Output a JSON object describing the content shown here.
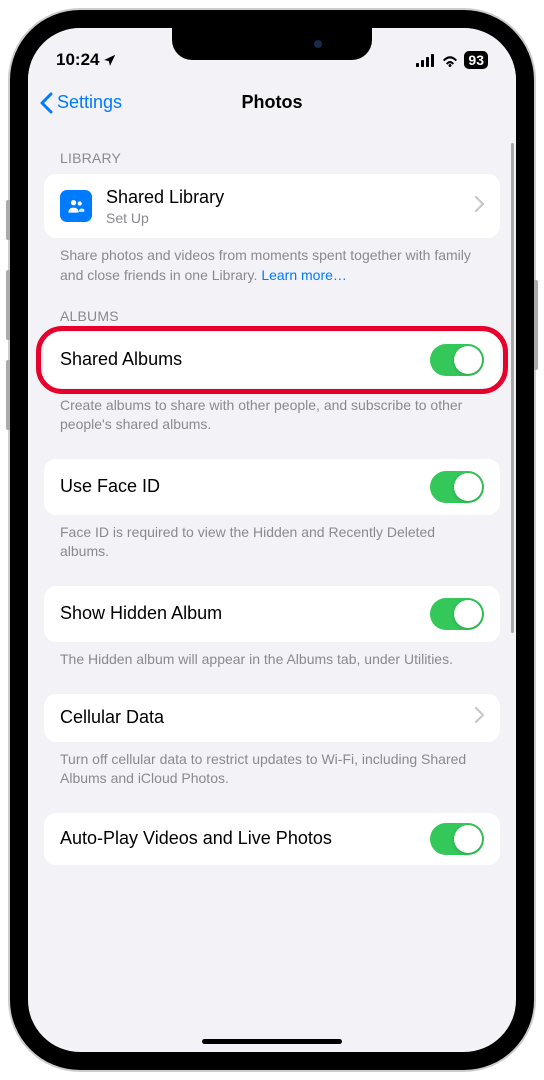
{
  "statusBar": {
    "time": "10:24",
    "battery": "93"
  },
  "nav": {
    "back": "Settings",
    "title": "Photos"
  },
  "sections": {
    "library": {
      "header": "LIBRARY",
      "sharedLibrary": {
        "title": "Shared Library",
        "subtitle": "Set Up"
      },
      "footer": "Share photos and videos from moments spent together with family and close friends in one Library.",
      "footerLink": "Learn more…"
    },
    "albums": {
      "header": "ALBUMS",
      "sharedAlbums": {
        "title": "Shared Albums"
      },
      "footer": "Create albums to share with other people, and subscribe to other people's shared albums."
    },
    "faceId": {
      "title": "Use Face ID",
      "footer": "Face ID is required to view the Hidden and Recently Deleted albums."
    },
    "hidden": {
      "title": "Show Hidden Album",
      "footer": "The Hidden album will appear in the Albums tab, under Utilities."
    },
    "cellular": {
      "title": "Cellular Data",
      "footer": "Turn off cellular data to restrict updates to Wi-Fi, including Shared Albums and iCloud Photos."
    },
    "autoplay": {
      "title": "Auto-Play Videos and Live Photos"
    }
  }
}
